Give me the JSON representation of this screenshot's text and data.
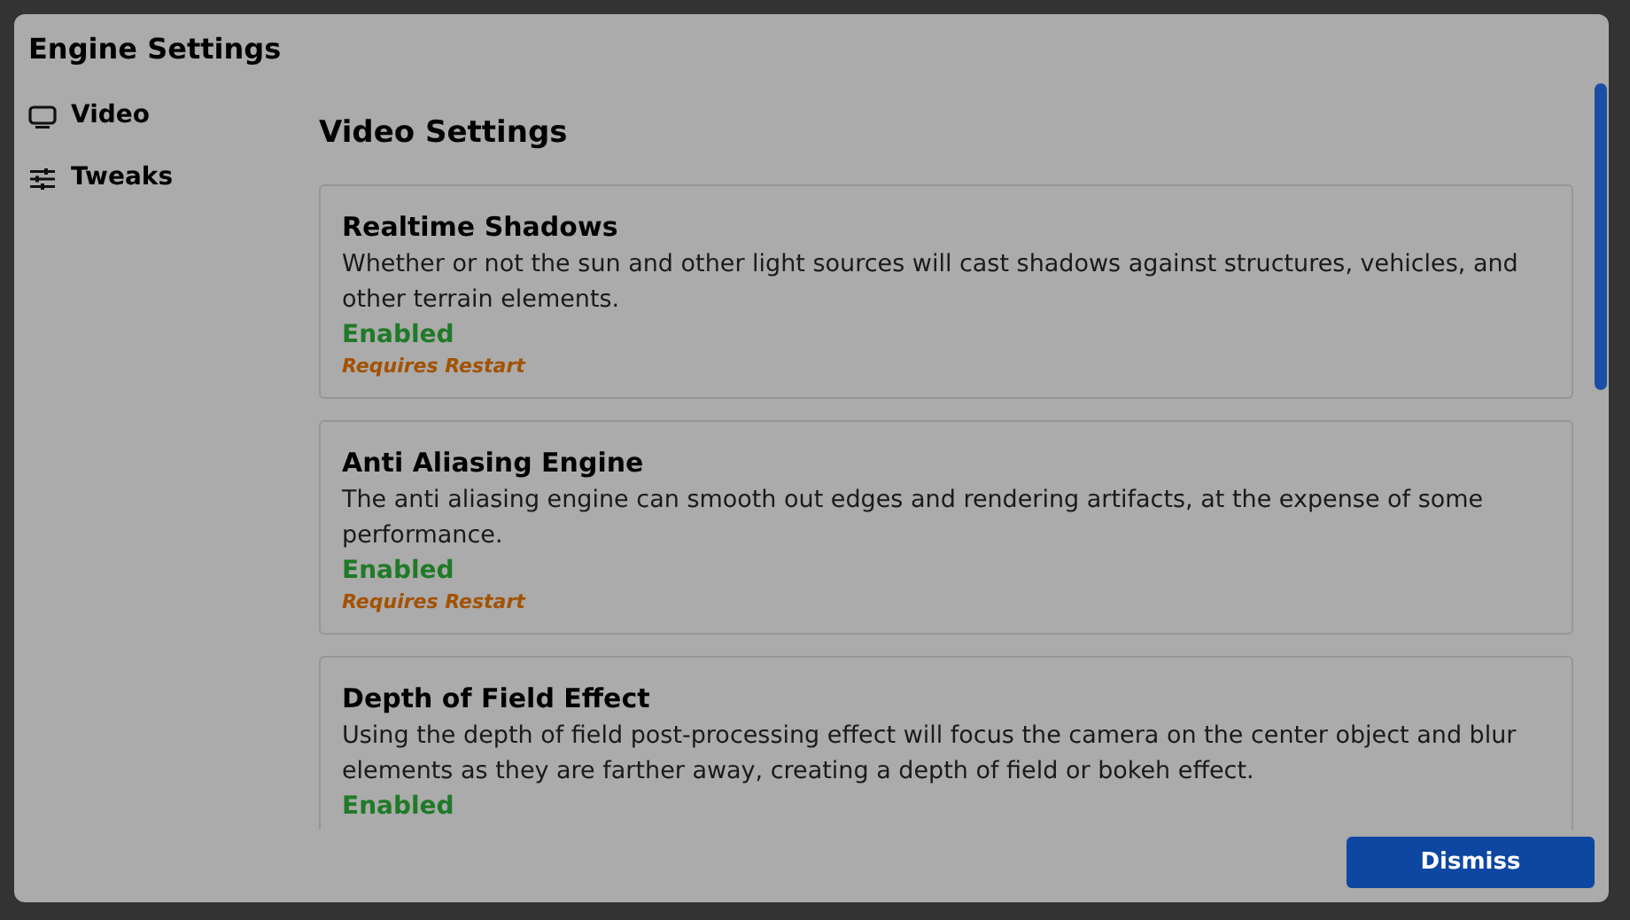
{
  "window": {
    "title": "Engine Settings"
  },
  "sidebar": {
    "items": [
      {
        "label": "Video"
      },
      {
        "label": "Tweaks"
      }
    ]
  },
  "content": {
    "heading": "Video Settings",
    "settings": [
      {
        "title": "Realtime Shadows",
        "description": "Whether or not the sun and other light sources will cast shadows against structures, vehicles, and other terrain elements.",
        "status": "Enabled",
        "note": "Requires Restart"
      },
      {
        "title": "Anti Aliasing Engine",
        "description": "The anti aliasing engine can smooth out edges and rendering artifacts, at the expense of some performance.",
        "status": "Enabled",
        "note": "Requires Restart"
      },
      {
        "title": "Depth of Field Effect",
        "description": "Using the depth of field post-processing effect will focus the camera on the center object and blur elements as they are farther away, creating a depth of field or bokeh effect.",
        "status": "Enabled"
      }
    ]
  },
  "buttons": [
    {
      "label": "Dismiss"
    }
  ]
}
